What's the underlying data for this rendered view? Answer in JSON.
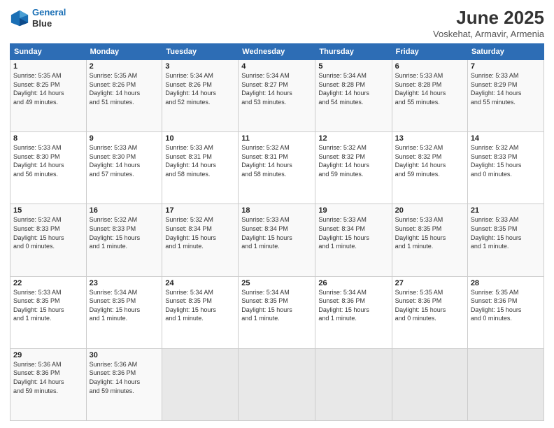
{
  "logo": {
    "line1": "General",
    "line2": "Blue"
  },
  "title": "June 2025",
  "subtitle": "Voskehat, Armavir, Armenia",
  "header_days": [
    "Sunday",
    "Monday",
    "Tuesday",
    "Wednesday",
    "Thursday",
    "Friday",
    "Saturday"
  ],
  "weeks": [
    [
      {
        "day": "1",
        "info": "Sunrise: 5:35 AM\nSunset: 8:25 PM\nDaylight: 14 hours\nand 49 minutes."
      },
      {
        "day": "2",
        "info": "Sunrise: 5:35 AM\nSunset: 8:26 PM\nDaylight: 14 hours\nand 51 minutes."
      },
      {
        "day": "3",
        "info": "Sunrise: 5:34 AM\nSunset: 8:26 PM\nDaylight: 14 hours\nand 52 minutes."
      },
      {
        "day": "4",
        "info": "Sunrise: 5:34 AM\nSunset: 8:27 PM\nDaylight: 14 hours\nand 53 minutes."
      },
      {
        "day": "5",
        "info": "Sunrise: 5:34 AM\nSunset: 8:28 PM\nDaylight: 14 hours\nand 54 minutes."
      },
      {
        "day": "6",
        "info": "Sunrise: 5:33 AM\nSunset: 8:28 PM\nDaylight: 14 hours\nand 55 minutes."
      },
      {
        "day": "7",
        "info": "Sunrise: 5:33 AM\nSunset: 8:29 PM\nDaylight: 14 hours\nand 55 minutes."
      }
    ],
    [
      {
        "day": "8",
        "info": "Sunrise: 5:33 AM\nSunset: 8:30 PM\nDaylight: 14 hours\nand 56 minutes."
      },
      {
        "day": "9",
        "info": "Sunrise: 5:33 AM\nSunset: 8:30 PM\nDaylight: 14 hours\nand 57 minutes."
      },
      {
        "day": "10",
        "info": "Sunrise: 5:33 AM\nSunset: 8:31 PM\nDaylight: 14 hours\nand 58 minutes."
      },
      {
        "day": "11",
        "info": "Sunrise: 5:32 AM\nSunset: 8:31 PM\nDaylight: 14 hours\nand 58 minutes."
      },
      {
        "day": "12",
        "info": "Sunrise: 5:32 AM\nSunset: 8:32 PM\nDaylight: 14 hours\nand 59 minutes."
      },
      {
        "day": "13",
        "info": "Sunrise: 5:32 AM\nSunset: 8:32 PM\nDaylight: 14 hours\nand 59 minutes."
      },
      {
        "day": "14",
        "info": "Sunrise: 5:32 AM\nSunset: 8:33 PM\nDaylight: 15 hours\nand 0 minutes."
      }
    ],
    [
      {
        "day": "15",
        "info": "Sunrise: 5:32 AM\nSunset: 8:33 PM\nDaylight: 15 hours\nand 0 minutes."
      },
      {
        "day": "16",
        "info": "Sunrise: 5:32 AM\nSunset: 8:33 PM\nDaylight: 15 hours\nand 1 minute."
      },
      {
        "day": "17",
        "info": "Sunrise: 5:32 AM\nSunset: 8:34 PM\nDaylight: 15 hours\nand 1 minute."
      },
      {
        "day": "18",
        "info": "Sunrise: 5:33 AM\nSunset: 8:34 PM\nDaylight: 15 hours\nand 1 minute."
      },
      {
        "day": "19",
        "info": "Sunrise: 5:33 AM\nSunset: 8:34 PM\nDaylight: 15 hours\nand 1 minute."
      },
      {
        "day": "20",
        "info": "Sunrise: 5:33 AM\nSunset: 8:35 PM\nDaylight: 15 hours\nand 1 minute."
      },
      {
        "day": "21",
        "info": "Sunrise: 5:33 AM\nSunset: 8:35 PM\nDaylight: 15 hours\nand 1 minute."
      }
    ],
    [
      {
        "day": "22",
        "info": "Sunrise: 5:33 AM\nSunset: 8:35 PM\nDaylight: 15 hours\nand 1 minute."
      },
      {
        "day": "23",
        "info": "Sunrise: 5:34 AM\nSunset: 8:35 PM\nDaylight: 15 hours\nand 1 minute."
      },
      {
        "day": "24",
        "info": "Sunrise: 5:34 AM\nSunset: 8:35 PM\nDaylight: 15 hours\nand 1 minute."
      },
      {
        "day": "25",
        "info": "Sunrise: 5:34 AM\nSunset: 8:35 PM\nDaylight: 15 hours\nand 1 minute."
      },
      {
        "day": "26",
        "info": "Sunrise: 5:34 AM\nSunset: 8:36 PM\nDaylight: 15 hours\nand 1 minute."
      },
      {
        "day": "27",
        "info": "Sunrise: 5:35 AM\nSunset: 8:36 PM\nDaylight: 15 hours\nand 0 minutes."
      },
      {
        "day": "28",
        "info": "Sunrise: 5:35 AM\nSunset: 8:36 PM\nDaylight: 15 hours\nand 0 minutes."
      }
    ],
    [
      {
        "day": "29",
        "info": "Sunrise: 5:36 AM\nSunset: 8:36 PM\nDaylight: 14 hours\nand 59 minutes."
      },
      {
        "day": "30",
        "info": "Sunrise: 5:36 AM\nSunset: 8:36 PM\nDaylight: 14 hours\nand 59 minutes."
      },
      {
        "day": "",
        "info": ""
      },
      {
        "day": "",
        "info": ""
      },
      {
        "day": "",
        "info": ""
      },
      {
        "day": "",
        "info": ""
      },
      {
        "day": "",
        "info": ""
      }
    ]
  ]
}
